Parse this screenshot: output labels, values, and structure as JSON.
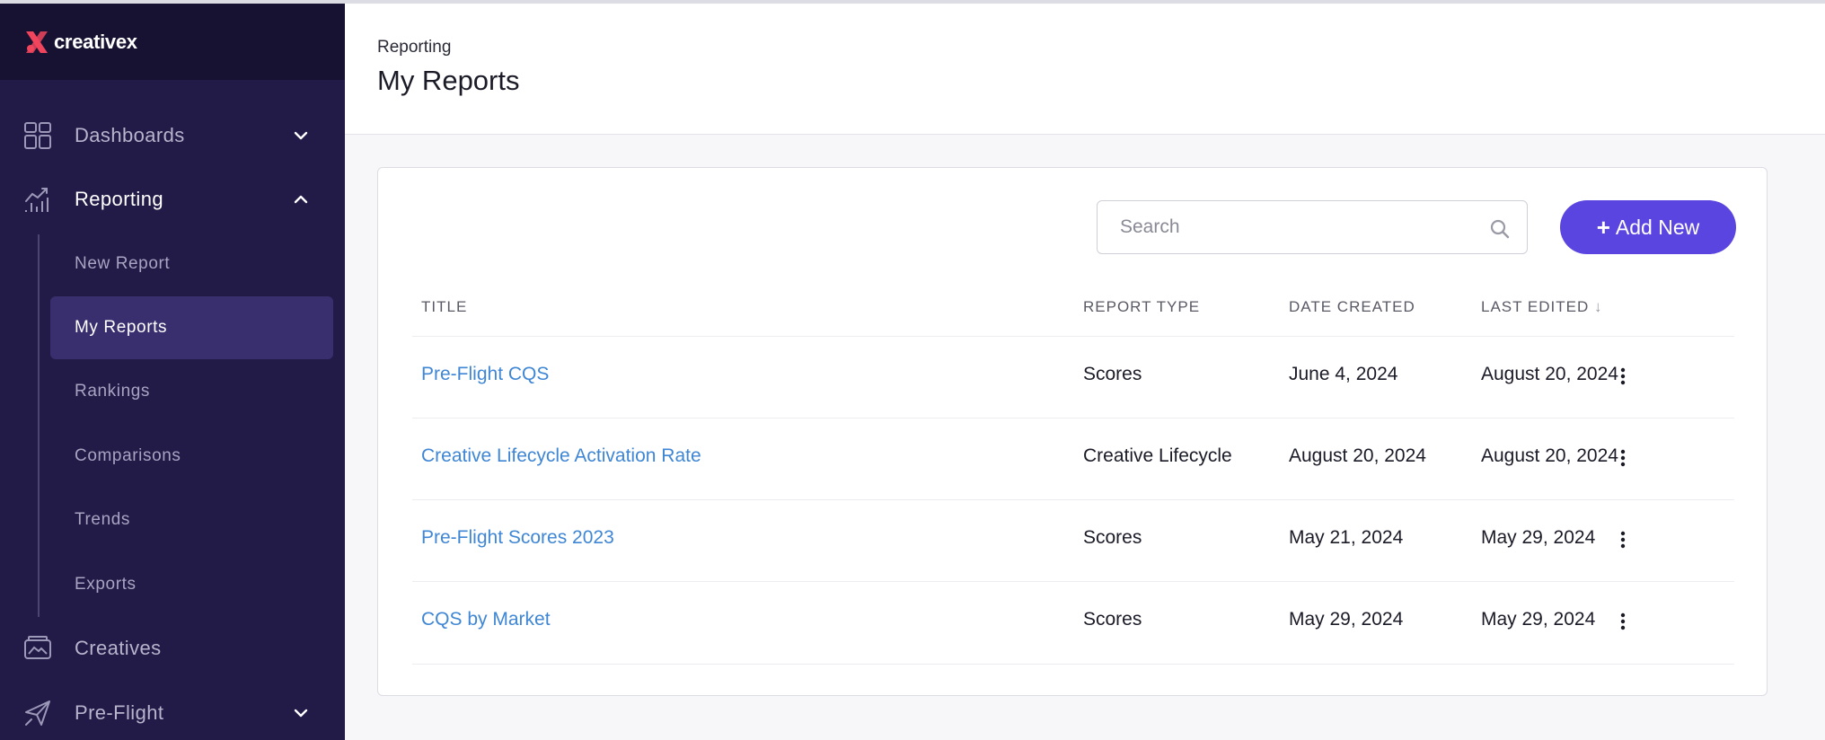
{
  "app": {
    "brand": "creativex"
  },
  "sidebar": {
    "items": [
      {
        "label": "Dashboards",
        "icon": "dashboard-grid-icon",
        "expanded": false
      },
      {
        "label": "Reporting",
        "icon": "chart-line-icon",
        "expanded": true
      },
      {
        "label": "Creatives",
        "icon": "creatives-icon",
        "expanded": false
      },
      {
        "label": "Pre-Flight",
        "icon": "paper-plane-icon",
        "expanded": false
      }
    ],
    "reporting_sub": [
      {
        "label": "New Report"
      },
      {
        "label": "My Reports",
        "selected": true
      },
      {
        "label": "Rankings"
      },
      {
        "label": "Comparisons"
      },
      {
        "label": "Trends"
      },
      {
        "label": "Exports"
      }
    ]
  },
  "header": {
    "breadcrumb": "Reporting",
    "title": "My Reports"
  },
  "toolbar": {
    "search_placeholder": "Search",
    "add_button": "Add New",
    "add_button_prefix": "+"
  },
  "table": {
    "columns": [
      "TITLE",
      "REPORT TYPE",
      "DATE CREATED",
      "LAST EDITED"
    ],
    "sort_indicator": "↓",
    "rows": [
      {
        "title": "Pre-Flight CQS",
        "type": "Scores",
        "created": "June 4, 2024",
        "edited": "August 20, 2024"
      },
      {
        "title": "Creative Lifecycle Activation Rate",
        "type": "Creative Lifecycle",
        "created": "August 20, 2024",
        "edited": "August 20, 2024"
      },
      {
        "title": "Pre-Flight Scores 2023",
        "type": "Scores",
        "created": "May 21, 2024",
        "edited": "May 29, 2024"
      },
      {
        "title": "CQS by Market",
        "type": "Scores",
        "created": "May 29, 2024",
        "edited": "May 29, 2024"
      }
    ]
  },
  "colors": {
    "sidebar_bg": "#221a47",
    "accent": "#5b45e0",
    "link": "#3f86d4",
    "selected_bg": "#3a2f6e"
  }
}
